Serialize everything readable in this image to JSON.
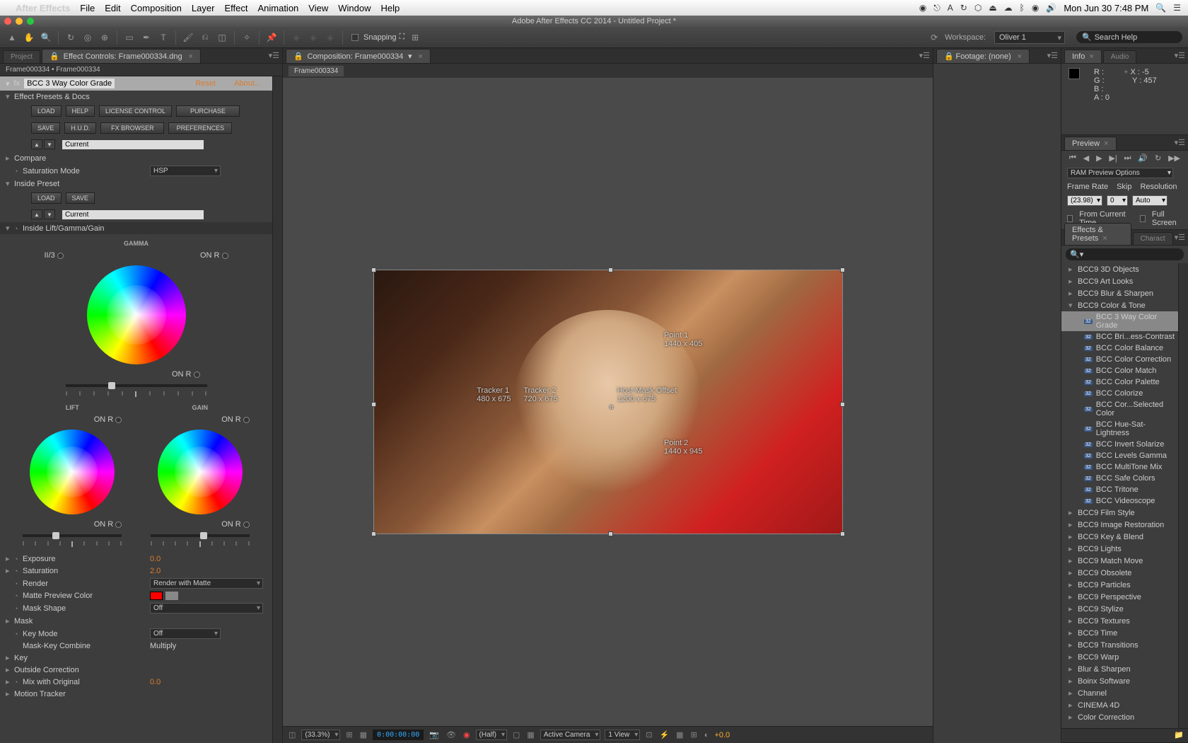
{
  "mac_menu": {
    "app": "After Effects",
    "items": [
      "File",
      "Edit",
      "Composition",
      "Layer",
      "Effect",
      "Animation",
      "View",
      "Window",
      "Help"
    ],
    "clock": "Mon Jun 30  7:48 PM"
  },
  "titlebar": "Adobe After Effects CC 2014 - Untitled Project *",
  "toolbar": {
    "snapping": "Snapping",
    "workspace_label": "Workspace:",
    "workspace": "Oliver 1",
    "search_placeholder": "Search Help"
  },
  "left": {
    "tab_project": "Project",
    "tab_fx": "Effect Controls: Frame000334.dng",
    "breadcrumb": "Frame000334 • Frame000334",
    "effect_name": "BCC 3 Way Color Grade",
    "reset": "Reset",
    "about": "About...",
    "presets_header": "Effect Presets & Docs",
    "buttons1": [
      "LOAD",
      "HELP",
      "LICENSE CONTROL",
      "PURCHASE"
    ],
    "buttons2": [
      "SAVE",
      "H.U.D.",
      "FX BROWSER",
      "PREFERENCES"
    ],
    "current_field": "Current",
    "compare": "Compare",
    "sat_mode_label": "Saturation Mode",
    "sat_mode_value": "HSP",
    "inside_preset": "Inside Preset",
    "inside_buttons": [
      "LOAD",
      "SAVE"
    ],
    "inside_field": "Current",
    "lgg_header": "Inside Lift/Gamma/Gain",
    "wheel_gamma": "GAMMA",
    "wheel_lift": "LIFT",
    "wheel_gain": "GAIN",
    "ii3": "II/3",
    "onr": "ON R",
    "params": {
      "exposure": {
        "label": "Exposure",
        "value": "0.0"
      },
      "saturation": {
        "label": "Saturation",
        "value": "2.0"
      },
      "render": {
        "label": "Render",
        "value": "Render with Matte"
      },
      "matte_prev": {
        "label": "Matte Preview Color"
      },
      "mask_shape": {
        "label": "Mask Shape",
        "value": "Off"
      },
      "mask": {
        "label": "Mask"
      },
      "key_mode": {
        "label": "Key Mode",
        "value": "Off"
      },
      "mask_key": {
        "label": "Mask-Key Combine",
        "value": "Multiply"
      },
      "key": {
        "label": "Key"
      },
      "outside": {
        "label": "Outside Correction"
      },
      "mix": {
        "label": "Mix with Original",
        "value": "0.0"
      },
      "tracker": {
        "label": "Motion Tracker"
      }
    }
  },
  "center": {
    "tab": "Composition: Frame000334",
    "subtab": "Frame000334",
    "overlays": {
      "tracker1": {
        "name": "Tracker 1",
        "coord": "480 x 675"
      },
      "tracker2": {
        "name": "Tracker 2",
        "coord": "720 x 675"
      },
      "hostmask": {
        "name": "Host Mask Offset",
        "coord": "1200 x 675"
      },
      "point1": {
        "name": "Point 1",
        "coord": "1440 x 405"
      },
      "point2": {
        "name": "Point 2",
        "coord": "1440 x 945"
      }
    },
    "footer": {
      "zoom": "(33.3%)",
      "time": "0:00:00:00",
      "res": "(Half)",
      "camera": "Active Camera",
      "views": "1 View",
      "exposure": "+0.0"
    }
  },
  "footage": {
    "tab": "Footage: (none)"
  },
  "info": {
    "tab_info": "Info",
    "tab_audio": "Audio",
    "r": "R :",
    "g": "G :",
    "b": "B :",
    "a": "A : 0",
    "x": "X : -5",
    "y": "Y : 457"
  },
  "preview": {
    "tab": "Preview",
    "ram_options": "RAM Preview Options",
    "hdr_rate": "Frame Rate",
    "hdr_skip": "Skip",
    "hdr_res": "Resolution",
    "rate": "(23.98)",
    "skip": "0",
    "res": "Auto",
    "from_current": "From Current Time",
    "full_screen": "Full Screen"
  },
  "ep": {
    "tab_ep": "Effects & Presets",
    "tab_char": "Charact",
    "groups_top": [
      "BCC9 3D Objects",
      "BCC9 Art Looks",
      "BCC9 Blur & Sharpen"
    ],
    "group_open": "BCC9 Color & Tone",
    "children": [
      "BCC 3 Way Color Grade",
      "BCC Bri...ess-Contrast",
      "BCC Color Balance",
      "BCC Color Correction",
      "BCC Color Match",
      "BCC Color Palette",
      "BCC Colorize",
      "BCC Cor...Selected Color",
      "BCC Hue-Sat-Lightness",
      "BCC Invert Solarize",
      "BCC Levels Gamma",
      "BCC MultiTone Mix",
      "BCC Safe Colors",
      "BCC Tritone",
      "BCC Videoscope"
    ],
    "groups_bottom": [
      "BCC9 Film Style",
      "BCC9 Image Restoration",
      "BCC9 Key & Blend",
      "BCC9 Lights",
      "BCC9 Match Move",
      "BCC9 Obsolete",
      "BCC9 Particles",
      "BCC9 Perspective",
      "BCC9 Stylize",
      "BCC9 Textures",
      "BCC9 Time",
      "BCC9 Transitions",
      "BCC9 Warp",
      "Blur & Sharpen",
      "Boinx Software",
      "Channel",
      "CINEMA 4D",
      "Color Correction"
    ]
  }
}
